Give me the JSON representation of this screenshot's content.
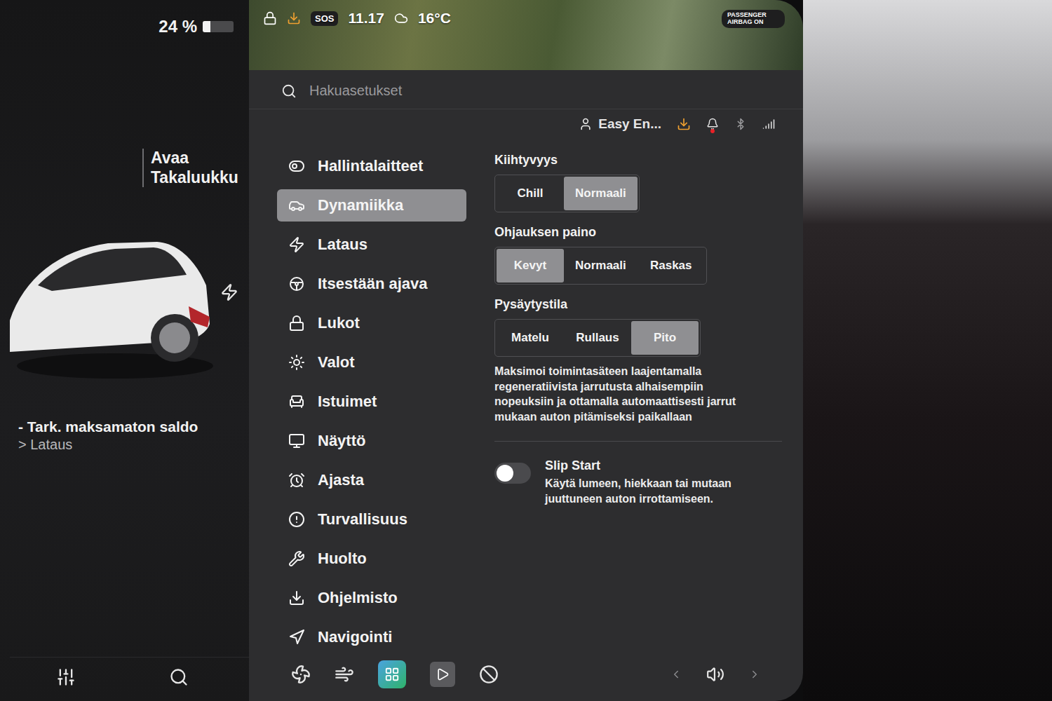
{
  "status_bar": {
    "battery": "24 %",
    "battery_level": 0.24,
    "sos": "SOS",
    "time": "11.17",
    "temperature": "16°C",
    "airbag": "PASSENGER AIRBAG ON"
  },
  "car_panel": {
    "trunk": "Avaa Takaluukku",
    "notice": "- Tark. maksamaton saldo",
    "notice_link": "> Lataus"
  },
  "search": {
    "placeholder": "Hakuasetukset"
  },
  "profile": {
    "name": "Easy En..."
  },
  "sidebar": {
    "items": [
      {
        "label": "Hallintalaitteet",
        "selected": false
      },
      {
        "label": "Dynamiikka",
        "selected": true
      },
      {
        "label": "Lataus",
        "selected": false
      },
      {
        "label": "Itsestään ajava",
        "selected": false
      },
      {
        "label": "Lukot",
        "selected": false
      },
      {
        "label": "Valot",
        "selected": false
      },
      {
        "label": "Istuimet",
        "selected": false
      },
      {
        "label": "Näyttö",
        "selected": false
      },
      {
        "label": "Ajasta",
        "selected": false
      },
      {
        "label": "Turvallisuus",
        "selected": false
      },
      {
        "label": "Huolto",
        "selected": false
      },
      {
        "label": "Ohjelmisto",
        "selected": false
      },
      {
        "label": "Navigointi",
        "selected": false
      }
    ]
  },
  "settings": {
    "groups": [
      {
        "title": "Kiihtyvyys",
        "options": [
          {
            "label": "Chill",
            "selected": false
          },
          {
            "label": "Normaali",
            "selected": true
          }
        ],
        "description": ""
      },
      {
        "title": "Ohjauksen paino",
        "options": [
          {
            "label": "Kevyt",
            "selected": true
          },
          {
            "label": "Normaali",
            "selected": false
          },
          {
            "label": "Raskas",
            "selected": false
          }
        ],
        "description": ""
      },
      {
        "title": "Pysäytystila",
        "options": [
          {
            "label": "Matelu",
            "selected": false
          },
          {
            "label": "Rullaus",
            "selected": false
          },
          {
            "label": "Pito",
            "selected": true
          }
        ],
        "description": "Maksimoi toimintasäteen laajentamalla regeneratiivista jarrutusta alhaisempiin nopeuksiin ja ottamalla automaattisesti jarrut mukaan auton pitämiseksi paikallaan"
      }
    ],
    "slip_start": {
      "title": "Slip Start",
      "description": "Käytä lumeen, hiekkaan tai mutaan juuttuneen auton irrottamiseen.",
      "on": false
    }
  }
}
